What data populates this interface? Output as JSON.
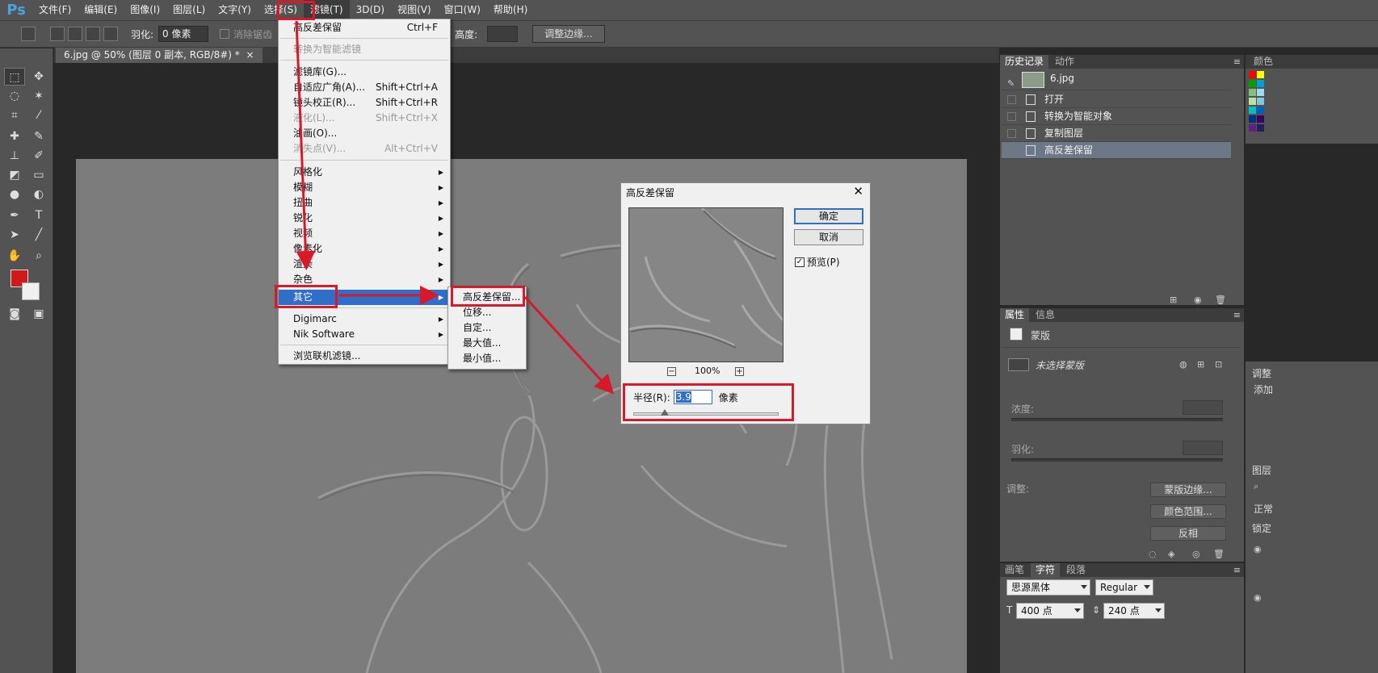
{
  "app": {
    "logo": "Ps"
  },
  "menubar": {
    "items": [
      "文件(F)",
      "编辑(E)",
      "图像(I)",
      "图层(L)",
      "文字(Y)",
      "选择(S)",
      "滤镜(T)",
      "3D(D)",
      "视图(V)",
      "窗口(W)",
      "帮助(H)"
    ]
  },
  "options": {
    "feather_label": "羽化:",
    "feather_value": "0 像素",
    "antialias_label": "消除锯齿",
    "height_label": "高度:",
    "refine_edge": "调整边缘..."
  },
  "document": {
    "tab": "6.jpg @ 50% (图层 0 副本, RGB/8#) *"
  },
  "filter_menu": {
    "items": [
      {
        "label": "高反差保留",
        "shortcut": "Ctrl+F"
      },
      {
        "label": "转换为智能滤镜",
        "disabled": true
      },
      {
        "label": "滤镜库(G)..."
      },
      {
        "label": "自适应广角(A)...",
        "shortcut": "Shift+Ctrl+A"
      },
      {
        "label": "镜头校正(R)...",
        "shortcut": "Shift+Ctrl+R"
      },
      {
        "label": "液化(L)...",
        "shortcut": "Shift+Ctrl+X",
        "disabled": true
      },
      {
        "label": "油画(O)..."
      },
      {
        "label": "消失点(V)...",
        "shortcut": "Alt+Ctrl+V",
        "disabled": true
      },
      {
        "label": "风格化"
      },
      {
        "label": "模糊"
      },
      {
        "label": "扭曲"
      },
      {
        "label": "锐化"
      },
      {
        "label": "视频"
      },
      {
        "label": "像素化"
      },
      {
        "label": "渲染"
      },
      {
        "label": "杂色"
      },
      {
        "label": "其它"
      },
      {
        "label": "Digimarc"
      },
      {
        "label": "Nik Software"
      },
      {
        "label": "浏览联机滤镜..."
      }
    ]
  },
  "other_submenu": {
    "items": [
      "高反差保留...",
      "位移...",
      "自定...",
      "最大值...",
      "最小值..."
    ]
  },
  "dialog": {
    "title": "高反差保留",
    "ok": "确定",
    "cancel": "取消",
    "preview_label": "预览(P)",
    "preview_checked": "✓",
    "zoom": "100%",
    "zoom_out": "−",
    "zoom_in": "+",
    "radius_label": "半径(R):",
    "radius_value": "3.9",
    "radius_unit": "像素",
    "close": "✕"
  },
  "history_panel": {
    "tabs": [
      "历史记录",
      "动作"
    ],
    "snapshot": "6.jpg",
    "items": [
      "打开",
      "转换为智能对象",
      "复制图层",
      "高反差保留"
    ],
    "active_index": 3
  },
  "swatches_tab": "颜色",
  "properties_panel": {
    "tabs": [
      "属性",
      "信息"
    ],
    "mask_label": "蒙版",
    "no_mask": "未选择蒙版",
    "density_label": "浓度:",
    "feather_label": "羽化:",
    "adjust_label": "调整:",
    "btn_mask_edge": "蒙版边缘...",
    "btn_color_range": "颜色范围...",
    "btn_invert": "反相"
  },
  "right_edge": {
    "adjust": "调整",
    "add": "添加",
    "layers": "图层",
    "normal": "正常",
    "lock": "锁定"
  },
  "character_panel": {
    "tabs": [
      "画笔",
      "字符",
      "段落"
    ],
    "font_family": "思源黑体",
    "font_style": "Regular",
    "font_size": "400 点",
    "leading": "240 点"
  },
  "colors": {
    "accent_red": "#d8192a",
    "highlight_blue": "#2f6fc9",
    "fg_color": "#d01a1a"
  }
}
